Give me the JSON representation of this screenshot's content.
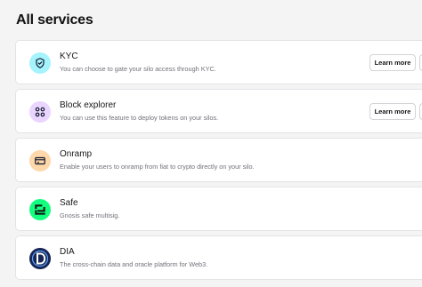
{
  "page": {
    "title": "All services"
  },
  "services": [
    {
      "title": "KYC",
      "description": "You can choose to gate your silo access through KYC.",
      "icon": "shield-check-icon",
      "icon_bg": "#a5f3fc",
      "learn_label": "Learn more"
    },
    {
      "title": "Block explorer",
      "description": "You can use this feature to deploy tokens on your silos.",
      "icon": "grid-icon",
      "icon_bg": "#e9d5ff",
      "learn_label": "Learn more"
    },
    {
      "title": "Onramp",
      "description": "Enable your users to onramp from fiat to crypto directly on your silo.",
      "icon": "credit-card-icon",
      "icon_bg": "#fed7aa"
    },
    {
      "title": "Safe",
      "description": "Gnosis safe multisig.",
      "icon": "safe-logo-icon",
      "icon_bg": "#12ff80"
    },
    {
      "title": "DIA",
      "description": "The cross-chain data and oracle platform for Web3.",
      "icon": "dia-logo-icon",
      "icon_bg": "#1e3a8a"
    }
  ]
}
